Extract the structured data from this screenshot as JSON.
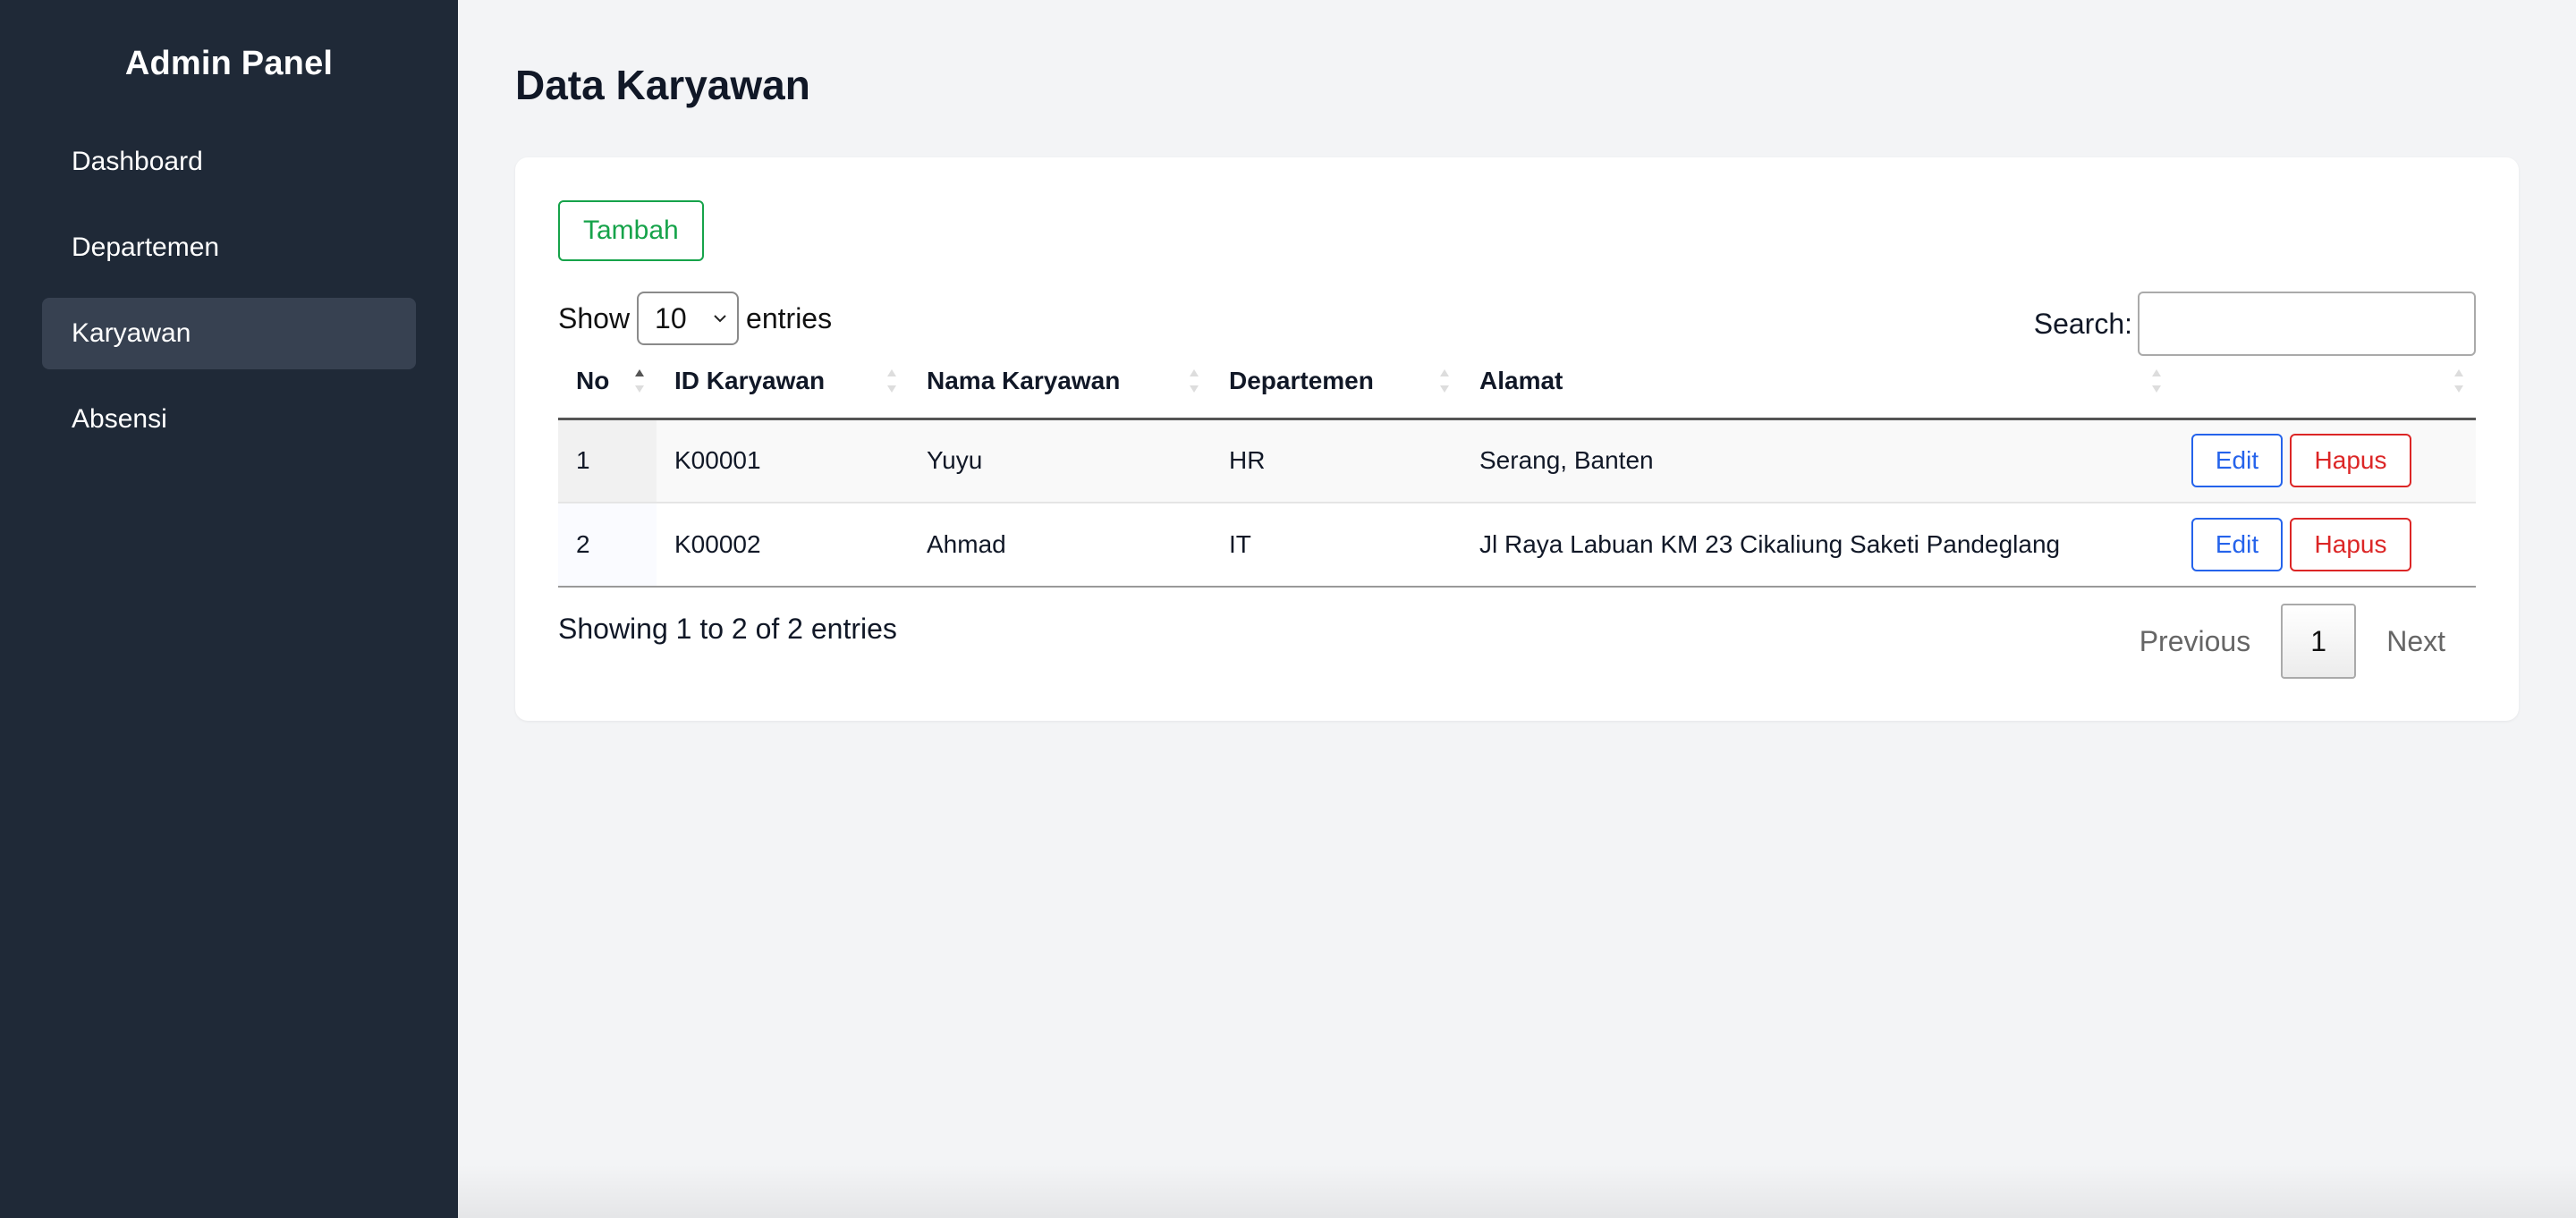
{
  "sidebar": {
    "brand": "Admin Panel",
    "items": [
      {
        "label": "Dashboard",
        "active": false
      },
      {
        "label": "Departemen",
        "active": false
      },
      {
        "label": "Karyawan",
        "active": true
      },
      {
        "label": "Absensi",
        "active": false
      }
    ]
  },
  "page": {
    "title": "Data Karyawan"
  },
  "toolbar": {
    "add_label": "Tambah"
  },
  "length": {
    "prefix": "Show",
    "value": "10",
    "suffix": "entries"
  },
  "search": {
    "label": "Search:",
    "value": ""
  },
  "table": {
    "columns": [
      "No",
      "ID Karyawan",
      "Nama Karyawan",
      "Departemen",
      "Alamat",
      ""
    ],
    "rows": [
      {
        "no": "1",
        "id": "K00001",
        "nama": "Yuyu",
        "departemen": "HR",
        "alamat": "Serang, Banten",
        "edit": "Edit",
        "hapus": "Hapus"
      },
      {
        "no": "2",
        "id": "K00002",
        "nama": "Ahmad",
        "departemen": "IT",
        "alamat": "Jl Raya Labuan KM 23 Cikaliung Saketi Pandeglang",
        "edit": "Edit",
        "hapus": "Hapus"
      }
    ]
  },
  "footer": {
    "info": "Showing 1 to 2 of 2 entries",
    "previous": "Previous",
    "current_page": "1",
    "next": "Next"
  },
  "colors": {
    "sidebar_bg": "#1f2937",
    "active_item_bg": "#374151",
    "add_button": "#16a34a",
    "edit_button": "#2563eb",
    "delete_button": "#dc2626"
  }
}
